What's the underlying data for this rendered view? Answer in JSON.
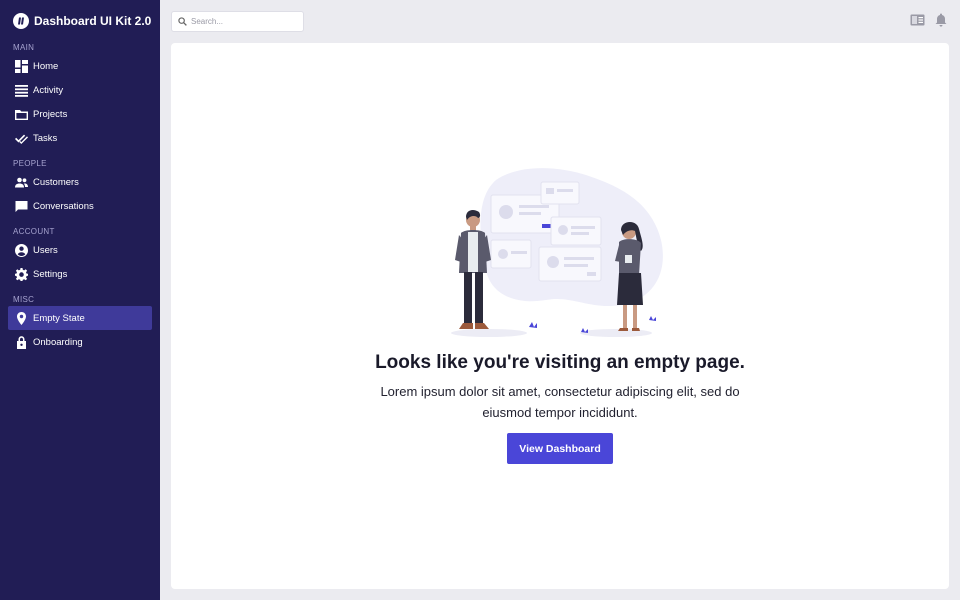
{
  "app": {
    "title": "Dashboard UI Kit 2.0"
  },
  "sidebar": {
    "sections": [
      {
        "label": "MAIN",
        "items": [
          {
            "label": "Home",
            "icon": "dashboard-icon"
          },
          {
            "label": "Activity",
            "icon": "list-icon"
          },
          {
            "label": "Projects",
            "icon": "folder-icon"
          },
          {
            "label": "Tasks",
            "icon": "double-check-icon"
          }
        ]
      },
      {
        "label": "PEOPLE",
        "items": [
          {
            "label": "Customers",
            "icon": "people-icon"
          },
          {
            "label": "Conversations",
            "icon": "chat-icon"
          }
        ]
      },
      {
        "label": "ACCOUNT",
        "items": [
          {
            "label": "Users",
            "icon": "user-circle-icon"
          },
          {
            "label": "Settings",
            "icon": "gear-icon"
          }
        ]
      },
      {
        "label": "MISC",
        "items": [
          {
            "label": "Empty State",
            "icon": "location-pin-icon",
            "active": true
          },
          {
            "label": "Onboarding",
            "icon": "lock-icon"
          }
        ]
      }
    ]
  },
  "topbar": {
    "search_placeholder": "Search...",
    "icons": [
      "reader-icon",
      "bell-icon"
    ]
  },
  "main": {
    "empty_title": "Looks like you're visiting an empty page.",
    "empty_description": "Lorem ipsum dolor sit amet, consectetur adipiscing elit, sed do eiusmod tempor incididunt.",
    "cta_label": "View Dashboard"
  },
  "colors": {
    "sidebar_bg": "#211d55",
    "active_item_bg": "#3f3a9a",
    "accent": "#4a46d8",
    "page_bg": "#ebebf0"
  }
}
